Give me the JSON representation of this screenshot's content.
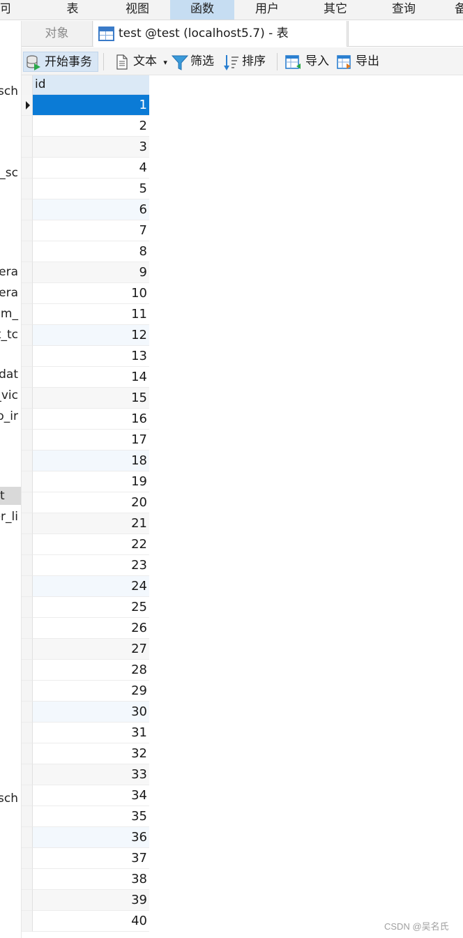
{
  "menu": {
    "items": [
      "可",
      "表",
      "视图",
      "函数",
      "用户",
      "其它",
      "查询",
      "备"
    ],
    "active_index": 3
  },
  "navigator": {
    "fragments": [
      "_sch",
      "e_sc",
      "lera",
      "lera",
      "em_",
      "t_tc",
      "dat",
      "_vic",
      "o_ir",
      "t",
      "er_li",
      "_sch"
    ],
    "selected_index": 9
  },
  "tabs": {
    "objects_label": "对象",
    "active_label": "test @test (localhost5.7) - 表"
  },
  "toolbar": {
    "begin_transaction": "开始事务",
    "text": "文本",
    "text_dropdown": "▾",
    "filter": "筛选",
    "sort": "排序",
    "import": "导入",
    "export": "导出"
  },
  "grid": {
    "columns": [
      "id"
    ],
    "rows": [
      1,
      2,
      3,
      4,
      5,
      6,
      7,
      8,
      9,
      10,
      11,
      12,
      13,
      14,
      15,
      16,
      17,
      18,
      19,
      20,
      21,
      22,
      23,
      24,
      25,
      26,
      27,
      28,
      29,
      30,
      31,
      32,
      33,
      34,
      35,
      36,
      37,
      38,
      39,
      40
    ],
    "selected_row": 0
  },
  "watermark": "CSDN @吴名氏",
  "colors": {
    "selection": "#0b7bd6",
    "header": "#dbe9f6",
    "active_menu": "#c6ddf2"
  }
}
